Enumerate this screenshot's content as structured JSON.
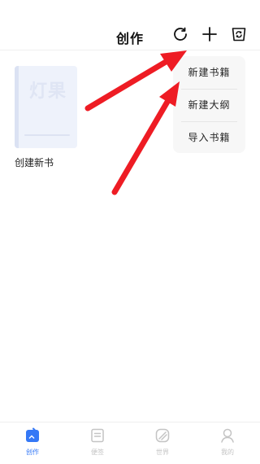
{
  "header": {
    "title": "创作"
  },
  "icons": {
    "refresh": "refresh-icon",
    "add": "plus-icon",
    "recycle": "recycle-bin-icon"
  },
  "book": {
    "cover_text": "灯果",
    "label": "创建新书"
  },
  "menu": {
    "items": [
      {
        "label": "新建书籍"
      },
      {
        "label": "新建大纲"
      },
      {
        "label": "导入书籍"
      }
    ]
  },
  "tabs": [
    {
      "label": "创作",
      "active": true
    },
    {
      "label": "便签",
      "active": false
    },
    {
      "label": "世界",
      "active": false
    },
    {
      "label": "我的",
      "active": false
    }
  ],
  "colors": {
    "accent": "#3478f6",
    "annotation": "#ee1c24",
    "inactive": "#c4c4c4"
  }
}
